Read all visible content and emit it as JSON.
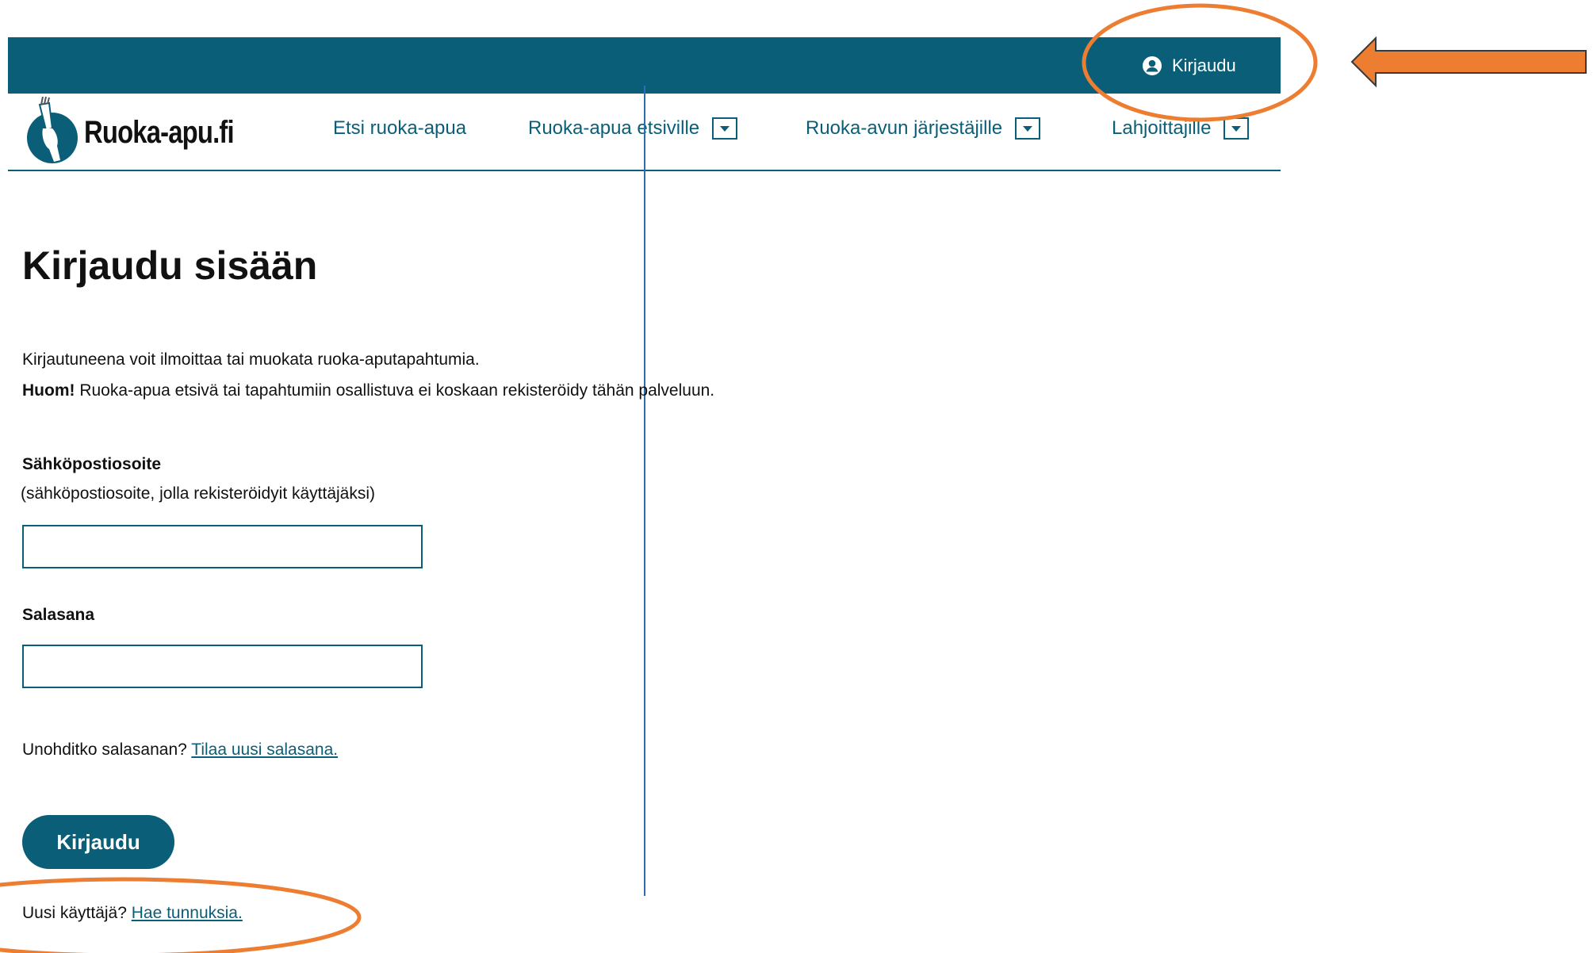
{
  "header": {
    "login_label": "Kirjaudu",
    "login_icon": "user-circle-icon",
    "brand_color": "#0b5e78"
  },
  "logo": {
    "text": "Ruoka-apu.fi"
  },
  "nav": {
    "items": [
      {
        "label": "Etsi ruoka-apua",
        "has_dropdown": false
      },
      {
        "label": "Ruoka-apua etsiville",
        "has_dropdown": true
      },
      {
        "label": "Ruoka-avun järjestäjille",
        "has_dropdown": true
      },
      {
        "label": "Lahjoittajille",
        "has_dropdown": true
      }
    ]
  },
  "main": {
    "title": "Kirjaudu sisään",
    "intro_line1": "Kirjautuneena voit ilmoittaa tai muokata ruoka-aputapahtumia.",
    "intro_note_bold": "Huom!",
    "intro_note_text": " Ruoka-apua etsivä tai tapahtumiin osallistuva ei koskaan rekisteröidy tähän palveluun.",
    "email_label": "Sähköpostiosoite",
    "email_hint": "(sähköpostiosoite, jolla rekisteröidyit käyttäjäksi)",
    "email_value": "",
    "password_label": "Salasana",
    "password_value": "",
    "forgot_text": "Unohditko salasanan? ",
    "forgot_link": "Tilaa uusi salasana.",
    "submit_label": "Kirjaudu",
    "new_user_text": "Uusi käyttäjä? ",
    "new_user_link": "Hae tunnuksia."
  },
  "annotations": {
    "highlight_color": "#ed7d31"
  }
}
